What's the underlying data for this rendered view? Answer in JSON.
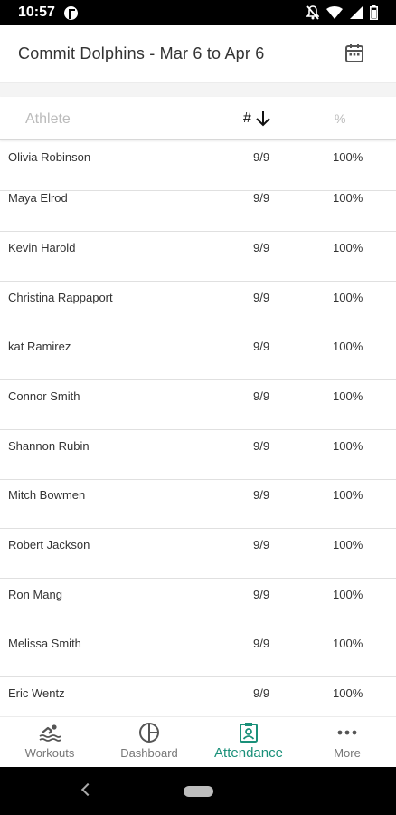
{
  "status_bar": {
    "time": "10:57"
  },
  "header": {
    "title": "Commit Dolphins - Mar 6 to Apr 6"
  },
  "table": {
    "columns": {
      "athlete": "Athlete",
      "count": "#",
      "percent": "%"
    },
    "rows": [
      {
        "name": "Olivia Robinson",
        "count": "9/9",
        "percent": "100%"
      },
      {
        "name": "Maya Elrod",
        "count": "9/9",
        "percent": "100%"
      },
      {
        "name": "Kevin Harold",
        "count": "9/9",
        "percent": "100%"
      },
      {
        "name": "Christina Rappaport",
        "count": "9/9",
        "percent": "100%"
      },
      {
        "name": "kat Ramirez",
        "count": "9/9",
        "percent": "100%"
      },
      {
        "name": "Connor Smith",
        "count": "9/9",
        "percent": "100%"
      },
      {
        "name": "Shannon Rubin",
        "count": "9/9",
        "percent": "100%"
      },
      {
        "name": "Mitch Bowmen",
        "count": "9/9",
        "percent": "100%"
      },
      {
        "name": "Robert Jackson",
        "count": "9/9",
        "percent": "100%"
      },
      {
        "name": "Ron Mang",
        "count": "9/9",
        "percent": "100%"
      },
      {
        "name": "Melissa Smith",
        "count": "9/9",
        "percent": "100%"
      },
      {
        "name": "Eric Wentz",
        "count": "9/9",
        "percent": "100%"
      }
    ]
  },
  "bottom_nav": {
    "items": [
      {
        "label": "Workouts",
        "icon": "swimmer-icon"
      },
      {
        "label": "Dashboard",
        "icon": "pie-chart-icon"
      },
      {
        "label": "Attendance",
        "icon": "attendance-badge-icon",
        "active": true
      },
      {
        "label": "More",
        "icon": "more-dots-icon"
      }
    ]
  },
  "colors": {
    "accent": "#1a9079",
    "icon_gray": "#555555",
    "label_gray": "#777777"
  }
}
